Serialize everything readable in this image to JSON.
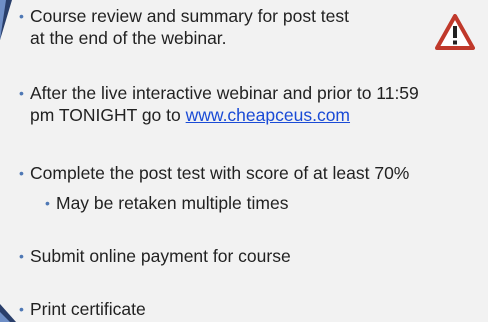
{
  "bullets": [
    {
      "lines": [
        "Course review and summary for post test",
        "at the end of the webinar."
      ]
    },
    {
      "line1": "After the live interactive webinar and prior to 11:59",
      "line2_prefix": "pm TONIGHT go to ",
      "link_text": "www.cheapceus.com"
    },
    {
      "line1": "Complete the post test with score of at least 70%"
    },
    {
      "line1": "Submit online payment for course"
    },
    {
      "line1": "Print certificate"
    }
  ],
  "sub_bullets": [
    {
      "line1": "May be retaken multiple times"
    }
  ],
  "icons": {
    "warning": "warning-icon",
    "bullet": "bullet-dot"
  },
  "colors": {
    "bullet": "#4f78b5",
    "link": "#1a4bd6",
    "warning_red": "#c0392b",
    "accent_dark": "#2a3f6b",
    "accent_light": "#6f8fc7"
  }
}
